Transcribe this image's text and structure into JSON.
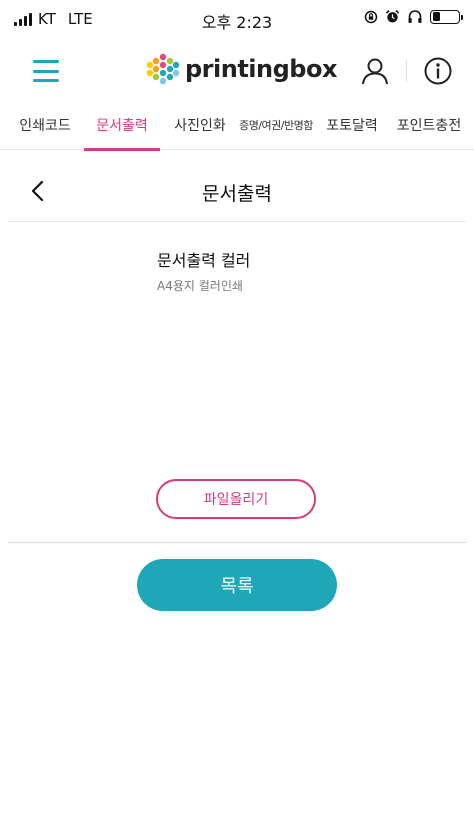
{
  "status_bar": {
    "carrier": "KT",
    "network": "LTE",
    "time": "오후 2:23",
    "icons": [
      "orientation-lock-icon",
      "alarm-icon",
      "headphones-icon",
      "battery-icon"
    ],
    "battery_level": 0.3
  },
  "header": {
    "logo_text": "printingbox",
    "icons": [
      "hamburger-menu-icon",
      "logo-cube-icon",
      "user-icon",
      "info-icon"
    ],
    "accent_color": "#1fa7b8"
  },
  "tabs": [
    {
      "label": "인쇄코드",
      "active": false
    },
    {
      "label": "문서출력",
      "active": true
    },
    {
      "label": "사진인화",
      "active": false
    },
    {
      "label": "증명/여권/반명함",
      "active": false
    },
    {
      "label": "포토달력",
      "active": false
    },
    {
      "label": "포인트충전",
      "active": false
    }
  ],
  "active_tab_color": "#d63c7a",
  "page": {
    "title": "문서출력",
    "back_icon": "chevron-left-icon"
  },
  "document": {
    "name": "문서출력 컬러",
    "description": "A4용지 컬러인쇄"
  },
  "buttons": {
    "upload_label": "파일올리기",
    "list_label": "목록"
  }
}
